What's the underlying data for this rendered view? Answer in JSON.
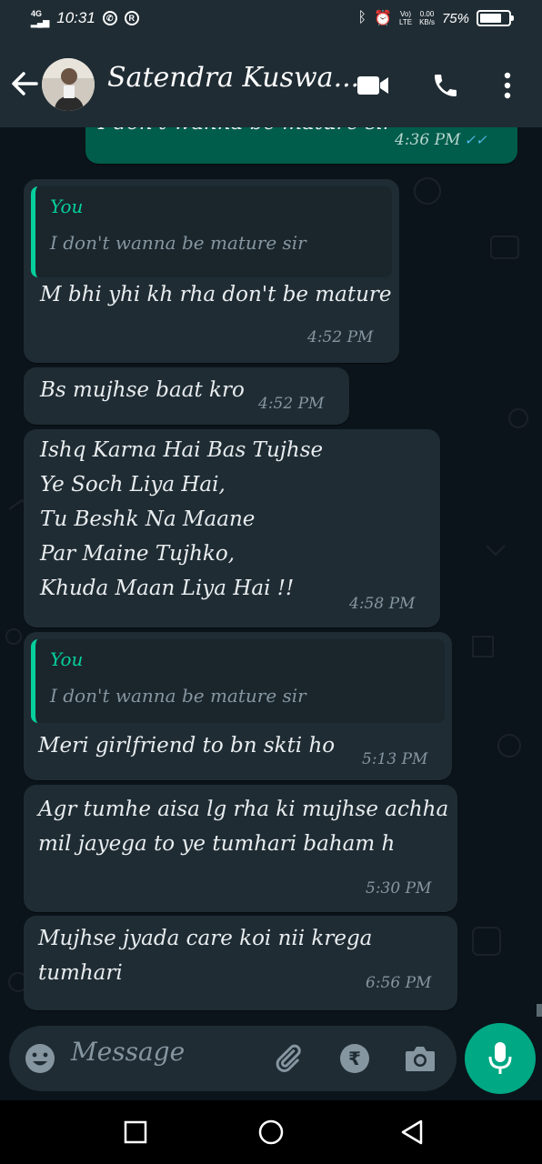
{
  "status_bar": {
    "network": "4G",
    "time": "10:31",
    "volte_top": "Vo)",
    "volte_bottom": "LTE",
    "speed_top": "0.00",
    "speed_bottom": "KB/s",
    "battery_percent": "75%",
    "battery_level": 0.75
  },
  "header": {
    "contact_name": "Satendra Kuswa..."
  },
  "messages": [
    {
      "type": "outgoing",
      "text": "I don't wanna be mature sir",
      "time": "4:36 PM",
      "ticks": "✓✓"
    },
    {
      "type": "incoming",
      "quote_author": "You",
      "quote_text": "I don't wanna be mature sir",
      "text": "M bhi yhi kh rha don't be mature",
      "time": "4:52 PM"
    },
    {
      "type": "incoming",
      "text": "Bs mujhse baat kro",
      "time": "4:52 PM"
    },
    {
      "type": "incoming",
      "lines": [
        "Ishq Karna Hai Bas Tujhse",
        "Ye Soch Liya Hai,",
        "Tu Beshk Na Maane",
        "Par Maine Tujhko,",
        "Khuda Maan Liya Hai !!"
      ],
      "time": "4:58 PM"
    },
    {
      "type": "incoming",
      "quote_author": "You",
      "quote_text": "I don't wanna be mature sir",
      "text": "Meri girlfriend to bn skti ho",
      "time": "5:13 PM"
    },
    {
      "type": "incoming",
      "lines": [
        "Agr tumhe aisa lg rha ki mujhse achha",
        "mil jayega to ye tumhari baham h"
      ],
      "time": "5:30 PM"
    },
    {
      "type": "incoming",
      "lines": [
        "Mujhse jyada care koi nii krega",
        "tumhari"
      ],
      "time": "6:56 PM"
    }
  ],
  "composer": {
    "placeholder": "Message"
  },
  "colors": {
    "accent": "#00a884",
    "quote_author": "#06cf9c",
    "read_ticks": "#53bdeb"
  }
}
